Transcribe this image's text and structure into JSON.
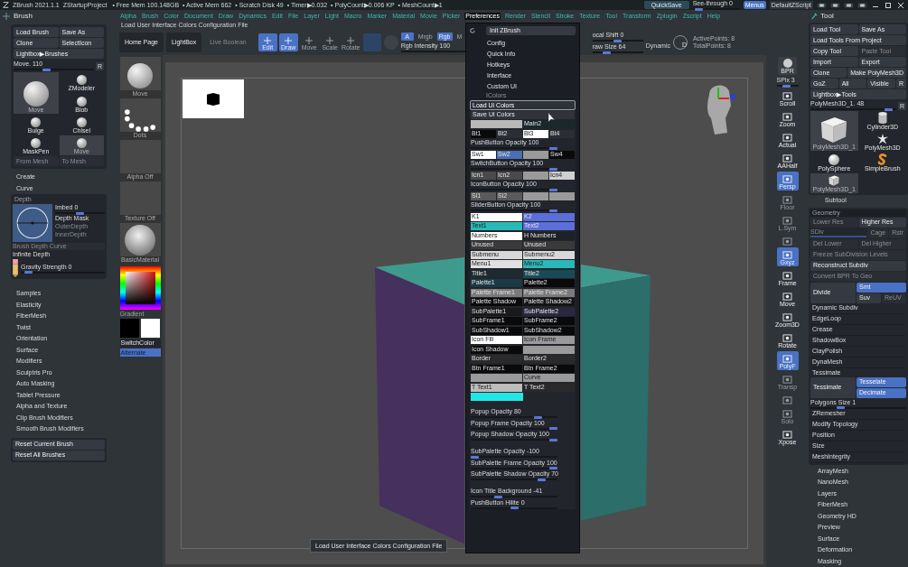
{
  "title_bar": {
    "app": "ZBrush 2021.1.1",
    "project": "ZStartupProject",
    "stats": [
      "• Free Mem 100.148GB",
      "• Active Mem 662",
      "• Scratch Disk 49",
      "• Timer▶0.032",
      "• PolyCount▶0.006 KP",
      "• MeshCount▶1"
    ],
    "quicksave": "QuickSave",
    "see_through": {
      "label": "See-through",
      "value": "0",
      "level": 0.05
    },
    "menus_toggle": {
      "label": "Menus",
      "selected": true
    },
    "script": "DefaultZScript"
  },
  "menu_bar": [
    {
      "label": "Alpha",
      "selected": false
    },
    {
      "label": "Brush",
      "selected": false
    },
    {
      "label": "Color",
      "selected": false
    },
    {
      "label": "Document",
      "selected": false
    },
    {
      "label": "Draw",
      "selected": false
    },
    {
      "label": "Dynamics",
      "selected": false
    },
    {
      "label": "Edit",
      "selected": false
    },
    {
      "label": "File",
      "selected": false
    },
    {
      "label": "Layer",
      "selected": false
    },
    {
      "label": "Light",
      "selected": false
    },
    {
      "label": "Macro",
      "selected": false
    },
    {
      "label": "Marker",
      "selected": false
    },
    {
      "label": "Material",
      "selected": false
    },
    {
      "label": "Movie",
      "selected": false
    },
    {
      "label": "Picker",
      "selected": false
    },
    {
      "label": "Preferences",
      "selected": true
    },
    {
      "label": "Render",
      "selected": false
    },
    {
      "label": "Stencil",
      "selected": false
    },
    {
      "label": "Stroke",
      "selected": false
    },
    {
      "label": "Texture",
      "selected": false
    },
    {
      "label": "Tool",
      "selected": false
    },
    {
      "label": "Transform",
      "selected": false
    },
    {
      "label": "Zplugin",
      "selected": false
    },
    {
      "label": "Zscript",
      "selected": false
    },
    {
      "label": "Help",
      "selected": false
    }
  ],
  "status_line": "Load User Interface Colors Configuration File",
  "toolbar": {
    "buttons": [
      {
        "label": "Home Page",
        "disabled": false
      },
      {
        "label": "LightBox",
        "disabled": false
      },
      {
        "label": "Live Boolean",
        "disabled": true
      }
    ],
    "modes": [
      {
        "label": "Edit",
        "selected": true
      },
      {
        "label": "Draw",
        "selected": true
      },
      {
        "label": "Move",
        "selected": false
      },
      {
        "label": "Scale",
        "selected": false
      },
      {
        "label": "Rotate",
        "selected": false
      }
    ],
    "channels": [
      {
        "label": "A",
        "selected": true
      },
      {
        "label": "Mrgb",
        "selected": false
      },
      {
        "label": "Rgb",
        "selected": true
      },
      {
        "label": "M",
        "selected": false
      }
    ],
    "rgb_intensity": {
      "label": "Rgb Intensity",
      "value": "100",
      "level": 1
    },
    "focal_shift": {
      "label": "ocal Shift",
      "value": "0",
      "level": 0.5
    },
    "draw_size": {
      "label": "raw Size",
      "value": "64",
      "level": 0.25
    },
    "dynamic": "Dynamic",
    "lazy": "D",
    "active_points": "ActivePoints: 8",
    "total_points": "TotalPoints: 8"
  },
  "brush_palette": {
    "title": "Brush",
    "button_rows": [
      [
        {
          "label": "Load Brush",
          "disabled": false
        },
        {
          "label": "Save As",
          "disabled": false
        }
      ],
      [
        {
          "label": "Clone",
          "disabled": false
        },
        {
          "label": "SelectIcon",
          "disabled": false
        }
      ],
      [
        {
          "label": "Lightbox▶Brushes",
          "disabled": false
        }
      ]
    ],
    "size_slider": {
      "label": "Move.",
      "value": "110",
      "level": 0.4
    },
    "reset": "R",
    "brushes": [
      {
        "label": "ZModeler",
        "selected": false,
        "big": false
      },
      {
        "label": "Move",
        "selected": true,
        "big": true
      },
      {
        "label": "Blob",
        "selected": false,
        "big": false
      },
      {
        "label": "Bulge",
        "selected": false,
        "big": false
      },
      {
        "label": "Chisel",
        "selected": false,
        "big": false
      },
      {
        "label": "MaskPen",
        "selected": false,
        "big": false
      },
      {
        "label": "Move",
        "selected": true,
        "big": false
      }
    ],
    "mesh_buttons": [
      {
        "label": "From Mesh",
        "disabled": true
      },
      {
        "label": "To Mesh",
        "disabled": true
      }
    ],
    "sections_top": [
      "Create",
      "Curve"
    ],
    "depth": {
      "title": "Depth",
      "imbed": {
        "label": "Imbed",
        "value": "0",
        "level": 0.5
      },
      "depth_mask": "Depth Mask",
      "outer": {
        "label": "OuterDepth",
        "disabled": true
      },
      "inner": {
        "label": "InnerDepth",
        "disabled": true
      },
      "curve": {
        "label": "Brush Depth Curve",
        "disabled": true
      },
      "infinite": "Infinite Depth",
      "gravity": {
        "label": "Gravity Strength",
        "value": "0",
        "level": 0.05
      }
    },
    "sections": [
      "Samples",
      "Elasticity",
      "FiberMesh",
      "Twist",
      "Orientation",
      "Surface",
      "Modifiers",
      "Sculptris Pro",
      "Auto Masking",
      "Tablet Pressure",
      "Alpha and Texture",
      "Clip Brush Modifiers",
      "Smooth Brush Modifiers"
    ],
    "reset_buttons": [
      {
        "label": "Reset Current Brush",
        "disabled": false
      },
      {
        "label": "Reset All Brushes",
        "disabled": false
      }
    ]
  },
  "side_column": {
    "thumbnails": [
      {
        "label": "Move",
        "kind": "brush"
      },
      {
        "label": "Dots",
        "kind": "stroke"
      },
      {
        "label": "Alpha Off",
        "kind": "empty"
      },
      {
        "label": "Texture Off",
        "kind": "empty"
      },
      {
        "label": "BasicMaterial",
        "kind": "material"
      }
    ],
    "gradient": "Gradient",
    "switch_color": "SwitchColor",
    "alternate": {
      "label": "Alternate",
      "selected": true
    }
  },
  "preferences_menu": {
    "init": "Init ZBrush",
    "items": [
      "Config",
      "Quick Info",
      "Hotkeys",
      "Interface",
      "Custom UI"
    ],
    "icolors_title": "IColors",
    "ui_buttons": [
      {
        "label": "Load Ui Colors",
        "selected": true
      },
      {
        "label": "Save Ui Colors",
        "selected": false
      }
    ],
    "rows": [
      {
        "kind": "swatches",
        "cells": [
          {
            "color": "#b8b8b8"
          },
          {
            "label": "Main2",
            "color": "#1c272b"
          }
        ]
      },
      {
        "kind": "swatches",
        "cells": [
          {
            "label": "Bt1",
            "color": "#0a0a0a"
          },
          {
            "label": "Bt2",
            "color": "#2b2e34"
          },
          {
            "label": "Bt3",
            "color": "#ffffff"
          },
          {
            "label": "Bt4",
            "color": "#2b2e34"
          }
        ]
      },
      {
        "kind": "slider",
        "label": "PushButton Opacity",
        "value": "100",
        "level": 1
      },
      {
        "kind": "swatches",
        "cells": [
          {
            "label": "Sw1",
            "color": "#ffffff"
          },
          {
            "label": "Sw2",
            "color": "#4a6fb5"
          },
          {
            "color": "#9a9a9a"
          },
          {
            "label": "Sw4",
            "color": "#0a0a0a"
          }
        ]
      },
      {
        "kind": "slider",
        "label": "SwitchButton Opacity",
        "value": "100",
        "level": 1
      },
      {
        "kind": "swatches",
        "cells": [
          {
            "label": "Icn1",
            "color": "#4a4a4a"
          },
          {
            "label": "Icn2",
            "color": "#4a4a4a"
          },
          {
            "color": "#9a9a9a"
          },
          {
            "label": "Icn4",
            "color": "#d0d0d0"
          }
        ]
      },
      {
        "kind": "slider",
        "label": "IconButton Opacity",
        "value": "100",
        "level": 1
      },
      {
        "kind": "swatches",
        "cells": [
          {
            "label": "Sl1",
            "color": "#5a5a5a"
          },
          {
            "label": "Sl2",
            "color": "#5a5a5a"
          },
          {
            "color": "#9a9a9a"
          },
          {
            "color": "#9a9a9a"
          }
        ]
      },
      {
        "kind": "slider",
        "label": "SliderButton Opacity",
        "value": "100",
        "level": 1
      },
      {
        "kind": "swatches",
        "cells": [
          {
            "label": "K1",
            "color": "#ffffff"
          },
          {
            "label": "K2",
            "color": "#5b6fd8"
          }
        ]
      },
      {
        "kind": "swatches",
        "cells": [
          {
            "label": "Text1",
            "color": "#2ab8b8"
          },
          {
            "label": "Text2",
            "color": "#5b6fd8"
          }
        ]
      },
      {
        "kind": "swatches",
        "cells": [
          {
            "label": "Numbers",
            "color": "#ffffff"
          },
          {
            "label": "H Numbers",
            "color": "#1e2228"
          }
        ]
      },
      {
        "kind": "swatches",
        "cells": [
          {
            "label": "Unused",
            "color": "#3a3a3a"
          },
          {
            "label": "Unused",
            "color": "#3a3a3a"
          }
        ]
      },
      {
        "kind": "swatches",
        "cells": [
          {
            "label": "Submenu",
            "color": "#d8d8d8"
          },
          {
            "label": "Submenu2",
            "color": "#d8d8d8"
          }
        ]
      },
      {
        "kind": "swatches",
        "cells": [
          {
            "label": "Menu1",
            "color": "#e0e0e0"
          },
          {
            "label": "Menu2",
            "color": "#2ab8b8"
          }
        ]
      },
      {
        "kind": "swatches",
        "cells": [
          {
            "label": "Title1",
            "color": "#1e2a30"
          },
          {
            "label": "Title2",
            "color": "#1a4a55"
          }
        ]
      },
      {
        "kind": "swatches",
        "cells": [
          {
            "label": "Palette1",
            "color": "#1a3a45"
          },
          {
            "label": "Palette2",
            "color": "#0a0a0a"
          }
        ]
      },
      {
        "kind": "swatches",
        "cells": [
          {
            "label": "Palette Frame1",
            "color": "#7a7a7a"
          },
          {
            "label": "Palette Frame2",
            "color": "#7a7a7a"
          }
        ]
      },
      {
        "kind": "swatches",
        "cells": [
          {
            "label": "Palette Shadow",
            "color": "#0a0a0a"
          },
          {
            "label": "Palette Shadow2",
            "color": "#141414"
          }
        ]
      },
      {
        "kind": "swatches",
        "cells": [
          {
            "label": "SubPalette1",
            "color": "#1a1a1a"
          },
          {
            "label": "SubPalette2",
            "color": "#2a2840"
          }
        ]
      },
      {
        "kind": "swatches",
        "cells": [
          {
            "label": "SubFrame1",
            "color": "#0a0a0a"
          },
          {
            "label": "SubFrame2",
            "color": "#0a0a0a"
          }
        ]
      },
      {
        "kind": "swatches",
        "cells": [
          {
            "label": "SubShadow1",
            "color": "#0a0a0a"
          },
          {
            "label": "SubShadow2",
            "color": "#0a0a0a"
          }
        ]
      },
      {
        "kind": "swatches",
        "cells": [
          {
            "label": "Icon Fill",
            "color": "#ffffff"
          },
          {
            "label": "Icon Frame",
            "color": "#9a9a9a"
          }
        ]
      },
      {
        "kind": "swatches",
        "cells": [
          {
            "label": "Icon Shadow",
            "color": "#0a0a0a"
          },
          {
            "color": "#9a9a9a"
          }
        ]
      },
      {
        "kind": "swatches",
        "cells": [
          {
            "label": "Border",
            "color": "#2a2a2a"
          },
          {
            "label": "Border2",
            "color": "#2a2a2a"
          }
        ]
      },
      {
        "kind": "swatches",
        "cells": [
          {
            "label": "Btn Frame1",
            "color": "#0a0a0a"
          },
          {
            "label": "Btn Frame2",
            "color": "#0a0a0a"
          }
        ]
      },
      {
        "kind": "swatches",
        "cells": [
          {
            "color": "#9a9a9a"
          },
          {
            "label": "Curve",
            "color": "#9a9a9a"
          }
        ]
      },
      {
        "kind": "swatches",
        "cells": [
          {
            "label": "T Text1",
            "color": "#bdbdbd"
          },
          {
            "label": "T Text2",
            "color": "#2a2a2a"
          }
        ]
      },
      {
        "kind": "swatches",
        "cells": [
          {
            "color": "#22e6e6"
          }
        ]
      },
      {
        "kind": "gap"
      },
      {
        "kind": "slider",
        "label": "Popup Opacity",
        "value": "80",
        "level": 0.8
      },
      {
        "kind": "slider",
        "label": "Popup Frame Opacity",
        "value": "100",
        "level": 1
      },
      {
        "kind": "slider",
        "label": "Popup Shadow Opacity",
        "value": "100",
        "level": 1
      },
      {
        "kind": "gap"
      },
      {
        "kind": "slider",
        "label": "SubPalette Opacity",
        "value": "-100",
        "level": 0
      },
      {
        "kind": "slider",
        "label": "SubPalette Frame Opacity",
        "value": "100",
        "level": 1
      },
      {
        "kind": "slider",
        "label": "SubPalette Shadow Opacity",
        "value": "70",
        "level": 0.85
      },
      {
        "kind": "gap"
      },
      {
        "kind": "slider",
        "label": "Icon Title Background",
        "value": "-41",
        "level": 0.3
      },
      {
        "kind": "slider",
        "label": "PushButton Hilite",
        "value": "0",
        "level": 0.5
      }
    ]
  },
  "shelf": {
    "bpr": "BPR",
    "spix": {
      "label": "SPix",
      "value": "3",
      "level": 0.4
    },
    "items": [
      {
        "label": "Scroll",
        "selected": false,
        "disabled": false
      },
      {
        "label": "Zoom",
        "selected": false,
        "disabled": false
      },
      {
        "label": "Actual",
        "selected": false,
        "disabled": false
      },
      {
        "label": "AAHalf",
        "selected": false,
        "disabled": false
      },
      {
        "label": "Persp",
        "selected": true,
        "disabled": false
      },
      {
        "label": "Floor",
        "selected": false,
        "disabled": true
      },
      {
        "label": "L.Sym",
        "selected": false,
        "disabled": true
      },
      {
        "selected": false,
        "disabled": true
      },
      {
        "label": "Gxyz",
        "selected": true,
        "disabled": false
      },
      {
        "label": "Frame",
        "selected": false,
        "disabled": false
      },
      {
        "label": "Move",
        "selected": false,
        "disabled": false
      },
      {
        "label": "Zoom3D",
        "selected": false,
        "disabled": false
      },
      {
        "label": "Rotate",
        "selected": false,
        "disabled": false
      },
      {
        "label": "PolyF",
        "selected": true,
        "disabled": false
      },
      {
        "label": "Transp",
        "selected": false,
        "disabled": true
      },
      {
        "selected": false,
        "disabled": true
      },
      {
        "label": "Solo",
        "selected": false,
        "disabled": true
      },
      {
        "label": "Xpose",
        "selected": false,
        "disabled": false
      }
    ]
  },
  "tool_palette": {
    "title": "Tool",
    "button_rows": [
      [
        {
          "label": "Load Tool",
          "disabled": false
        },
        {
          "label": "Save As",
          "disabled": false
        }
      ],
      [
        {
          "label": "Load Tools From Project",
          "disabled": false
        }
      ],
      [
        {
          "label": "Copy Tool",
          "disabled": false
        },
        {
          "label": "Paste Tool",
          "disabled": true
        }
      ],
      [
        {
          "label": "Import",
          "disabled": false
        },
        {
          "label": "Export",
          "disabled": false
        }
      ],
      [
        {
          "label": "Clone",
          "disabled": false
        },
        {
          "label": "Make PolyMesh3D",
          "disabled": false
        }
      ],
      [
        {
          "label": "GoZ",
          "disabled": false
        },
        {
          "label": "All",
          "disabled": false
        },
        {
          "label": "Visible",
          "disabled": false
        },
        {
          "label": "R",
          "disabled": false
        }
      ],
      [
        {
          "label": "Lightbox▶Tools",
          "disabled": false
        }
      ]
    ],
    "tool_slider": {
      "label": "PolyMesh3D_1.",
      "value": "48",
      "level": 0.95
    },
    "reset": "R",
    "tools": [
      {
        "label": "Cylinder3D",
        "kind": "cylinder",
        "selected": false,
        "big": false
      },
      {
        "label": "PolyMesh3D_1",
        "kind": "cube",
        "selected": true,
        "big": true
      },
      {
        "label": "PolyMesh3D",
        "kind": "star",
        "selected": false,
        "big": false
      },
      {
        "label": "PolySphere",
        "kind": "sphere",
        "selected": false,
        "big": false
      },
      {
        "label": "SimpleBrush",
        "kind": "brush",
        "selected": false,
        "big": false
      },
      {
        "label": "PolyMesh3D_1",
        "kind": "cube",
        "selected": true,
        "big": false
      }
    ],
    "subtool": "Subtool",
    "geometry": {
      "title": "Geometry",
      "res": [
        {
          "label": "Lower Res",
          "disabled": true
        },
        {
          "label": "Higher Res",
          "disabled": false
        }
      ],
      "sdiv": {
        "label": "SDiv",
        "disabled": true,
        "level": 1
      },
      "cage": [
        {
          "label": "Cage",
          "disabled": true
        },
        {
          "label": "Rstr",
          "disabled": true
        }
      ],
      "del": [
        {
          "label": "Del Lower",
          "disabled": true
        },
        {
          "label": "Del Higher",
          "disabled": true
        }
      ],
      "wide": [
        {
          "label": "Freeze SubDivision Levels",
          "disabled": true
        },
        {
          "label": "Reconstruct Subdiv",
          "disabled": false
        },
        {
          "label": "Convert BPR To Geo",
          "disabled": true
        }
      ],
      "divide": {
        "label": "Divide",
        "disabled": false
      },
      "divide_opts": [
        {
          "label": "Smt",
          "selected": true,
          "disabled": false
        },
        {
          "label": "Suv",
          "selected": false,
          "disabled": false
        },
        {
          "label": "ReUV",
          "selected": false,
          "disabled": true
        }
      ],
      "items": [
        "Dynamic Subdiv",
        "EdgeLoop",
        "Crease",
        "ShadowBox",
        "ClayPolish",
        "DynaMesh"
      ],
      "tessimate": {
        "title": "Tessimate",
        "button": {
          "label": "Tessimate",
          "disabled": false
        },
        "opts": [
          {
            "label": "Tesselate",
            "selected": true,
            "disabled": false
          },
          {
            "label": "Decimate",
            "selected": true,
            "disabled": false
          }
        ],
        "polygons": {
          "label": "Polygons Size",
          "value": "1",
          "level": 0.3
        }
      },
      "items_after": [
        "ZRemesher",
        "Modify Topology",
        "Position",
        "Size",
        "MeshIntegrity"
      ]
    },
    "sections": [
      "ArrayMesh",
      "NanoMesh",
      "Layers",
      "FiberMesh",
      "Geometry HD",
      "Preview",
      "Surface",
      "Deformation",
      "Masking"
    ]
  },
  "tooltip": "Load User Interface Colors Configuration File"
}
